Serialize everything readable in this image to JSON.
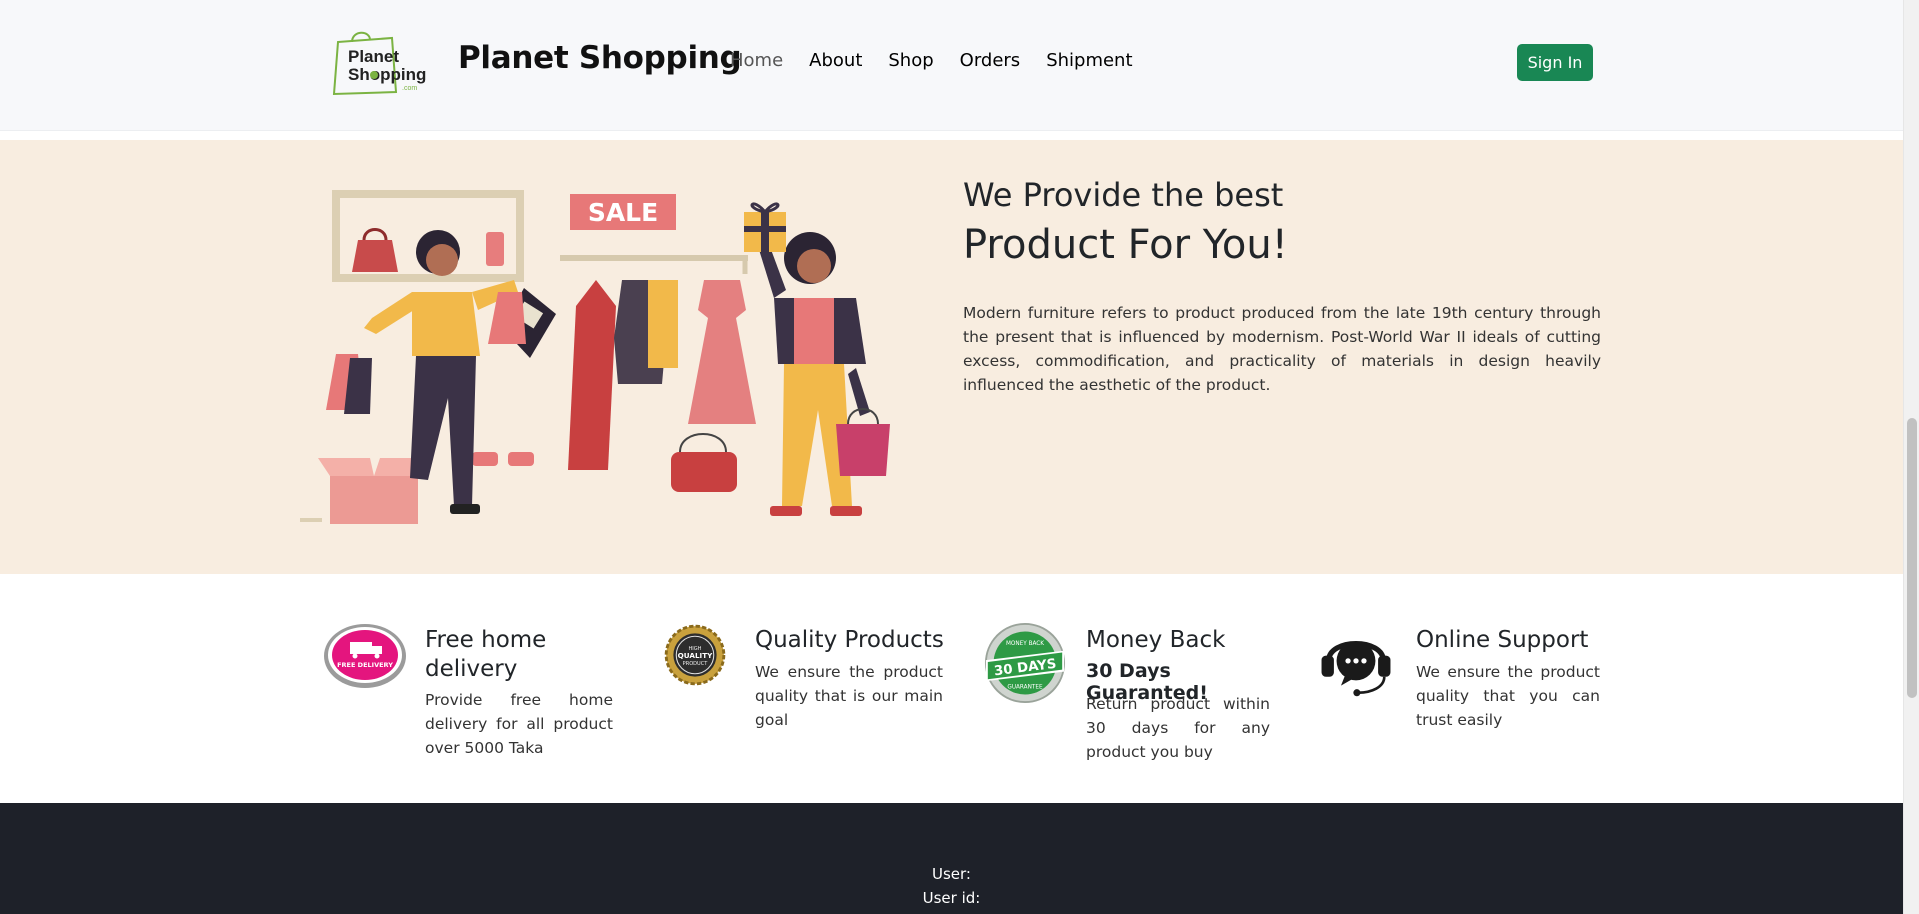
{
  "header": {
    "logo_text": "Planet Shopping .com",
    "brand": "Planet Shopping",
    "nav": [
      "Home",
      "About",
      "Shop",
      "Orders",
      "Shipment"
    ],
    "sign_in": "Sign In"
  },
  "hero": {
    "heading_1": "We Provide the best",
    "heading_2": "Product For You!",
    "paragraph": "Modern furniture refers to product produced from the late 19th century through the present that is influenced by modernism. Post-World War II ideals of cutting excess, commodification, and practicality of materials in design heavily influenced the aesthetic of the product.",
    "sale_sign": "SALE"
  },
  "features": [
    {
      "icon": "free-delivery-badge",
      "badge_text": "FREE DELIVERY",
      "title": "Free home delivery",
      "desc": "Provide free home delivery for all product over 5000 Taka"
    },
    {
      "icon": "quality-seal",
      "badge_text": "HIGH QUALITY PRODUCT",
      "title": "Quality Products",
      "desc": "We ensure the product quality that is our main goal"
    },
    {
      "icon": "money-back-seal",
      "badge_text": "30 DAYS",
      "title": "Money Back",
      "subtitle": "30 Days Guaranted!",
      "desc": "Return product within 30 days for any product you buy"
    },
    {
      "icon": "headset-support-icon",
      "title": "Online Support",
      "desc": "We ensure the product quality that you can trust easily"
    }
  ],
  "footer": {
    "user_label": "User:",
    "user_id_label": "User id:"
  },
  "colors": {
    "header_bg": "#f7f8fa",
    "hero_bg": "#f8ede0",
    "sign_in_bg": "#198754",
    "footer_bg": "#1e2129"
  }
}
